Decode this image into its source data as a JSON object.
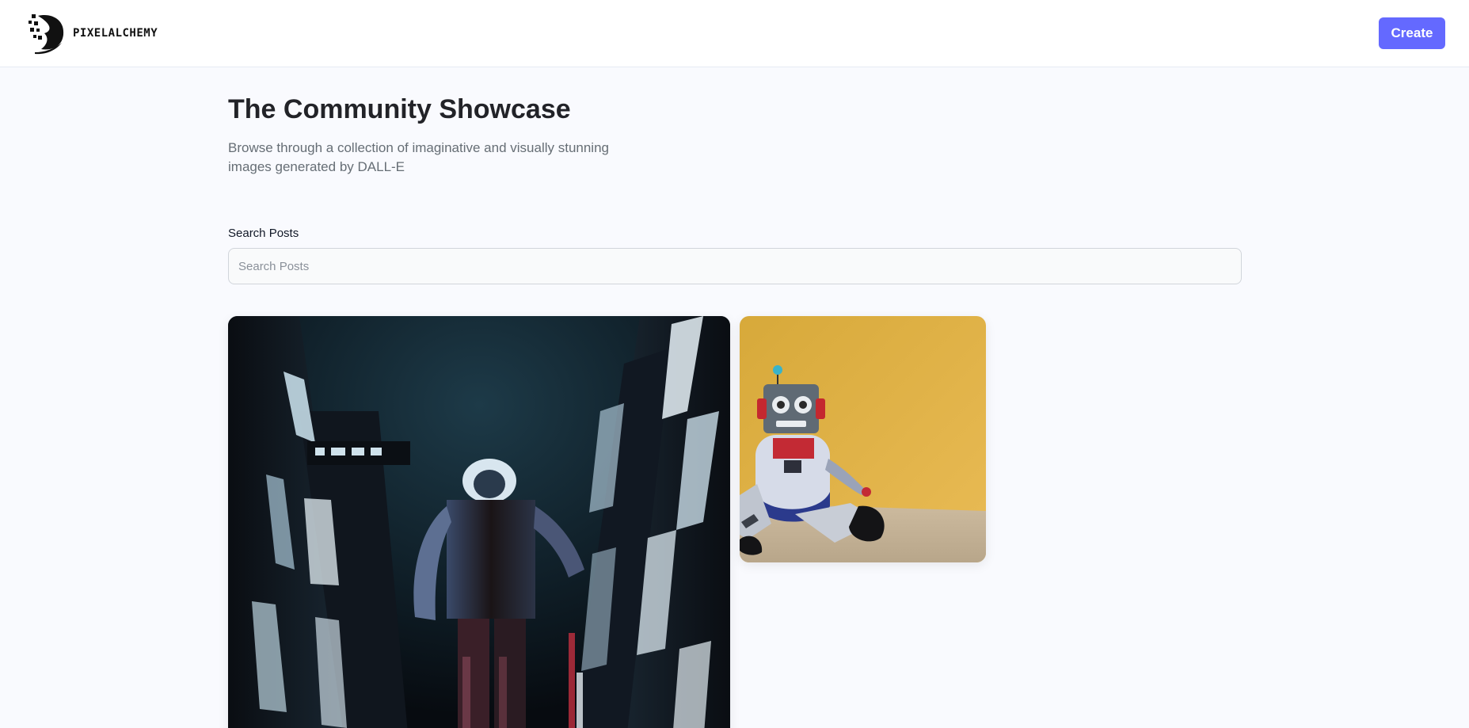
{
  "header": {
    "logo_text": "PIXELALCHEMY",
    "logo_icon": "pixel-leaf-logo-icon",
    "create_label": "Create",
    "accent_color": "#6469ff"
  },
  "showcase": {
    "title": "The Community Showcase",
    "subtitle": "Browse through a collection of imaginative and visually stunning images generated by DALL-E"
  },
  "search": {
    "label": "Search Posts",
    "placeholder": "Search Posts",
    "value": ""
  },
  "gallery": {
    "posts": [
      {
        "image": "robot-city-night-image"
      },
      {
        "image": "plush-robot-toy-image"
      }
    ]
  }
}
